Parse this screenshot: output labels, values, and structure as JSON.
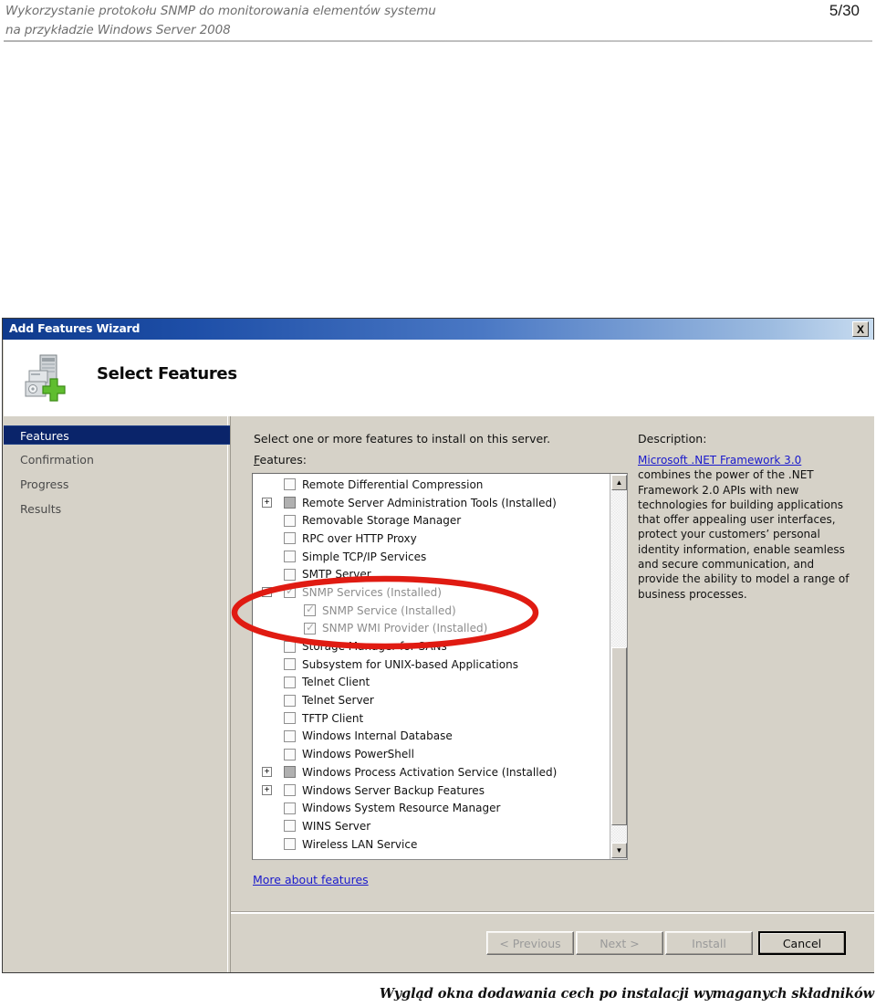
{
  "page_header": {
    "title_line1": "Wykorzystanie protokołu SNMP do monitorowania elementów systemu",
    "title_line2": "na przykładzie Windows Server 2008",
    "page_number": "5/30"
  },
  "window": {
    "title": "Add Features Wizard",
    "close_label": "X",
    "banner_title": "Select Features",
    "icon": "server-add-icon"
  },
  "sidebar": {
    "items": [
      {
        "label": "Features",
        "selected": true
      },
      {
        "label": "Confirmation",
        "selected": false
      },
      {
        "label": "Progress",
        "selected": false
      },
      {
        "label": "Results",
        "selected": false
      }
    ]
  },
  "content": {
    "intro": "Select one or more features to install on this server.",
    "features_label_accel": "F",
    "features_label_rest": "eatures:",
    "description_label": "Description:",
    "more_link": "More about features"
  },
  "description": {
    "link_text": "Microsoft .NET Framework 3.0",
    "body": " combines the power of the .NET Framework 2.0 APIs with new technologies for building applications that offer appealing user interfaces, protect your customers’ personal identity information, enable seamless and secure communication, and provide the ability to model a range of business processes."
  },
  "tree": {
    "items": [
      {
        "label": "Remote Differential Compression",
        "level": 1,
        "checkbox": "empty",
        "expander": "",
        "dim": false
      },
      {
        "label": "Remote Server Administration Tools  (Installed)",
        "level": 1,
        "checkbox": "partial",
        "expander": "+",
        "dim": false
      },
      {
        "label": "Removable Storage Manager",
        "level": 1,
        "checkbox": "empty",
        "expander": "",
        "dim": false
      },
      {
        "label": "RPC over HTTP Proxy",
        "level": 1,
        "checkbox": "empty",
        "expander": "",
        "dim": false
      },
      {
        "label": "Simple TCP/IP Services",
        "level": 1,
        "checkbox": "empty",
        "expander": "",
        "dim": false
      },
      {
        "label": "SMTP Server",
        "level": 1,
        "checkbox": "empty",
        "expander": "",
        "dim": false
      },
      {
        "label": "SNMP Services  (Installed)",
        "level": 1,
        "checkbox": "checked",
        "expander": "−",
        "dim": true
      },
      {
        "label": "SNMP Service  (Installed)",
        "level": 2,
        "checkbox": "checked",
        "expander": "",
        "dim": true
      },
      {
        "label": "SNMP WMI Provider  (Installed)",
        "level": 2,
        "checkbox": "checked",
        "expander": "",
        "dim": true
      },
      {
        "label": "Storage Manager for SANs",
        "level": 1,
        "checkbox": "empty",
        "expander": "",
        "dim": false
      },
      {
        "label": "Subsystem for UNIX-based Applications",
        "level": 1,
        "checkbox": "empty",
        "expander": "",
        "dim": false
      },
      {
        "label": "Telnet Client",
        "level": 1,
        "checkbox": "empty",
        "expander": "",
        "dim": false
      },
      {
        "label": "Telnet Server",
        "level": 1,
        "checkbox": "empty",
        "expander": "",
        "dim": false
      },
      {
        "label": "TFTP Client",
        "level": 1,
        "checkbox": "empty",
        "expander": "",
        "dim": false
      },
      {
        "label": "Windows Internal Database",
        "level": 1,
        "checkbox": "empty",
        "expander": "",
        "dim": false
      },
      {
        "label": "Windows PowerShell",
        "level": 1,
        "checkbox": "empty",
        "expander": "",
        "dim": false
      },
      {
        "label": "Windows Process Activation Service  (Installed)",
        "level": 1,
        "checkbox": "partial",
        "expander": "+",
        "dim": false
      },
      {
        "label": "Windows Server Backup Features",
        "level": 1,
        "checkbox": "empty",
        "expander": "+",
        "dim": false
      },
      {
        "label": "Windows System Resource Manager",
        "level": 1,
        "checkbox": "empty",
        "expander": "",
        "dim": false
      },
      {
        "label": "WINS Server",
        "level": 1,
        "checkbox": "empty",
        "expander": "",
        "dim": false
      },
      {
        "label": "Wireless LAN Service",
        "level": 1,
        "checkbox": "empty",
        "expander": "",
        "dim": false
      }
    ],
    "scroll_up_glyph": "▲",
    "scroll_down_glyph": "▼"
  },
  "buttons": {
    "previous": "< Previous",
    "previous_accel": "P",
    "next": "Next >",
    "next_accel": "N",
    "install": "Install",
    "install_accel": "I",
    "cancel": "Cancel"
  },
  "annotation": {
    "shape": "ellipse",
    "color": "#e01b12"
  },
  "caption": "Wygląd okna dodawania cech po instalacji wymaganych składników"
}
